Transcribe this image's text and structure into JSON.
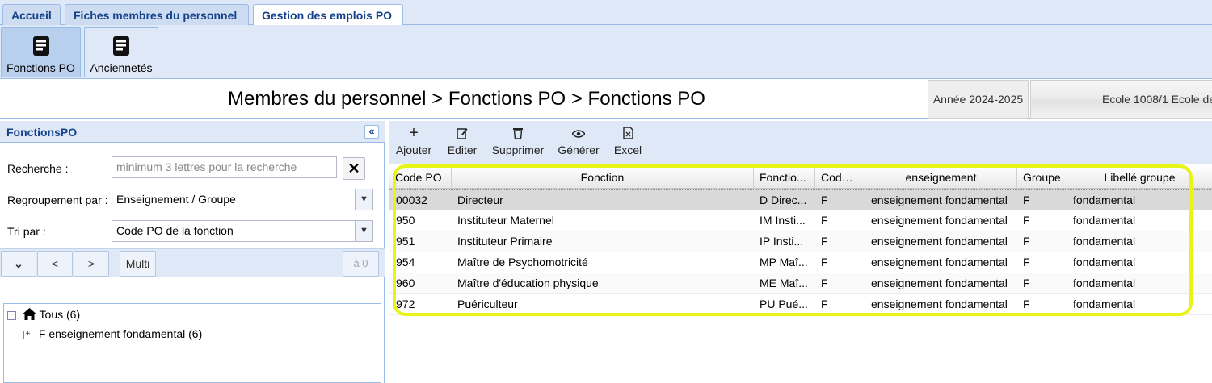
{
  "tabs": [
    {
      "label": "Accueil"
    },
    {
      "label": "Fiches membres du personnel"
    },
    {
      "label": "Gestion des emplois PO"
    }
  ],
  "ribbon": {
    "buttons": [
      {
        "label": "Fonctions PO",
        "icon": "document-icon"
      },
      {
        "label": "Anciennetés",
        "icon": "document-icon"
      }
    ]
  },
  "breadcrumb": "Membres du personnel > Fonctions PO > Fonctions PO",
  "annee": "Année 2024-2025",
  "ecole": "Ecole 1008/1 Ecole de",
  "left_panel": {
    "title": "FonctionsPO",
    "collapse_glyph": "«",
    "recherche_label": "Recherche :",
    "recherche_placeholder": "minimum 3 lettres pour la recherche",
    "regroupement_label": "Regroupement par :",
    "regroupement_value": "Enseignement / Groupe",
    "tri_label": "Tri par :",
    "tri_value": "Code PO de la fonction",
    "nav": {
      "down": "⌄",
      "prev": "<",
      "next": ">",
      "multi": "Multi",
      "a0": "à 0"
    },
    "tree": [
      {
        "label": "Tous (6)",
        "toggle": "−"
      },
      {
        "label": "F enseignement fondamental (6)",
        "toggle": "+"
      }
    ]
  },
  "toolbar": {
    "ajouter": "Ajouter",
    "editer": "Editer",
    "supprimer": "Supprimer",
    "generer": "Générer",
    "excel": "Excel"
  },
  "grid": {
    "columns": [
      "Code PO",
      "Fonction",
      "Fonctio...",
      "Code ...",
      "enseignement",
      "Groupe",
      "Libellé groupe"
    ],
    "rows": [
      [
        "00032",
        "Directeur",
        "D Direc...",
        "F",
        "enseignement fondamental",
        "F",
        "fondamental"
      ],
      [
        "950",
        "Instituteur Maternel",
        "IM Insti...",
        "F",
        "enseignement fondamental",
        "F",
        "fondamental"
      ],
      [
        "951",
        "Instituteur Primaire",
        "IP Insti...",
        "F",
        "enseignement fondamental",
        "F",
        "fondamental"
      ],
      [
        "954",
        "Maître de Psychomotricité",
        "MP Maî...",
        "F",
        "enseignement fondamental",
        "F",
        "fondamental"
      ],
      [
        "960",
        "Maître d'éducation physique",
        "ME Maî...",
        "F",
        "enseignement fondamental",
        "F",
        "fondamental"
      ],
      [
        "972",
        "Puériculteur",
        "PU Pué...",
        "F",
        "enseignement fondamental",
        "F",
        "fondamental"
      ]
    ],
    "selected_row": 0
  },
  "colors": {
    "panel_blue": "#dfe8f6",
    "border_blue": "#99bbe8",
    "title_blue": "#15428b",
    "highlight": "#e6f516",
    "selected_row": "#d9d9d9"
  }
}
